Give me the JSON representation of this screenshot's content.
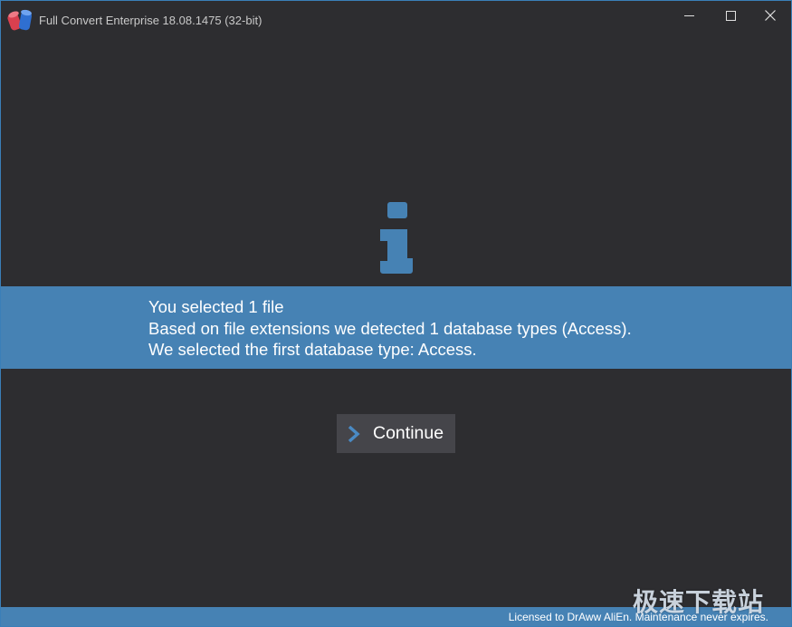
{
  "window": {
    "title": "Full Convert Enterprise 18.08.1475 (32-bit)",
    "controls": {
      "minimize": "minimize-icon",
      "maximize": "maximize-icon",
      "close": "close-icon"
    }
  },
  "main": {
    "icon": "info-icon",
    "message": {
      "line1": "You selected 1 file",
      "line2": "Based on file extensions we detected 1 database types (Access).",
      "line3": "We selected the first database type: Access."
    },
    "continue_button": {
      "label": "Continue",
      "icon": "chevron-right-icon"
    }
  },
  "status_bar": {
    "license": "Licensed to DrAww AliEn. Maintenance never expires."
  },
  "watermark": {
    "text": "极速下载站"
  },
  "colors": {
    "background": "#2d2d30",
    "accent": "#4682b4",
    "button_bg": "#45454a",
    "text": "#ffffff"
  }
}
